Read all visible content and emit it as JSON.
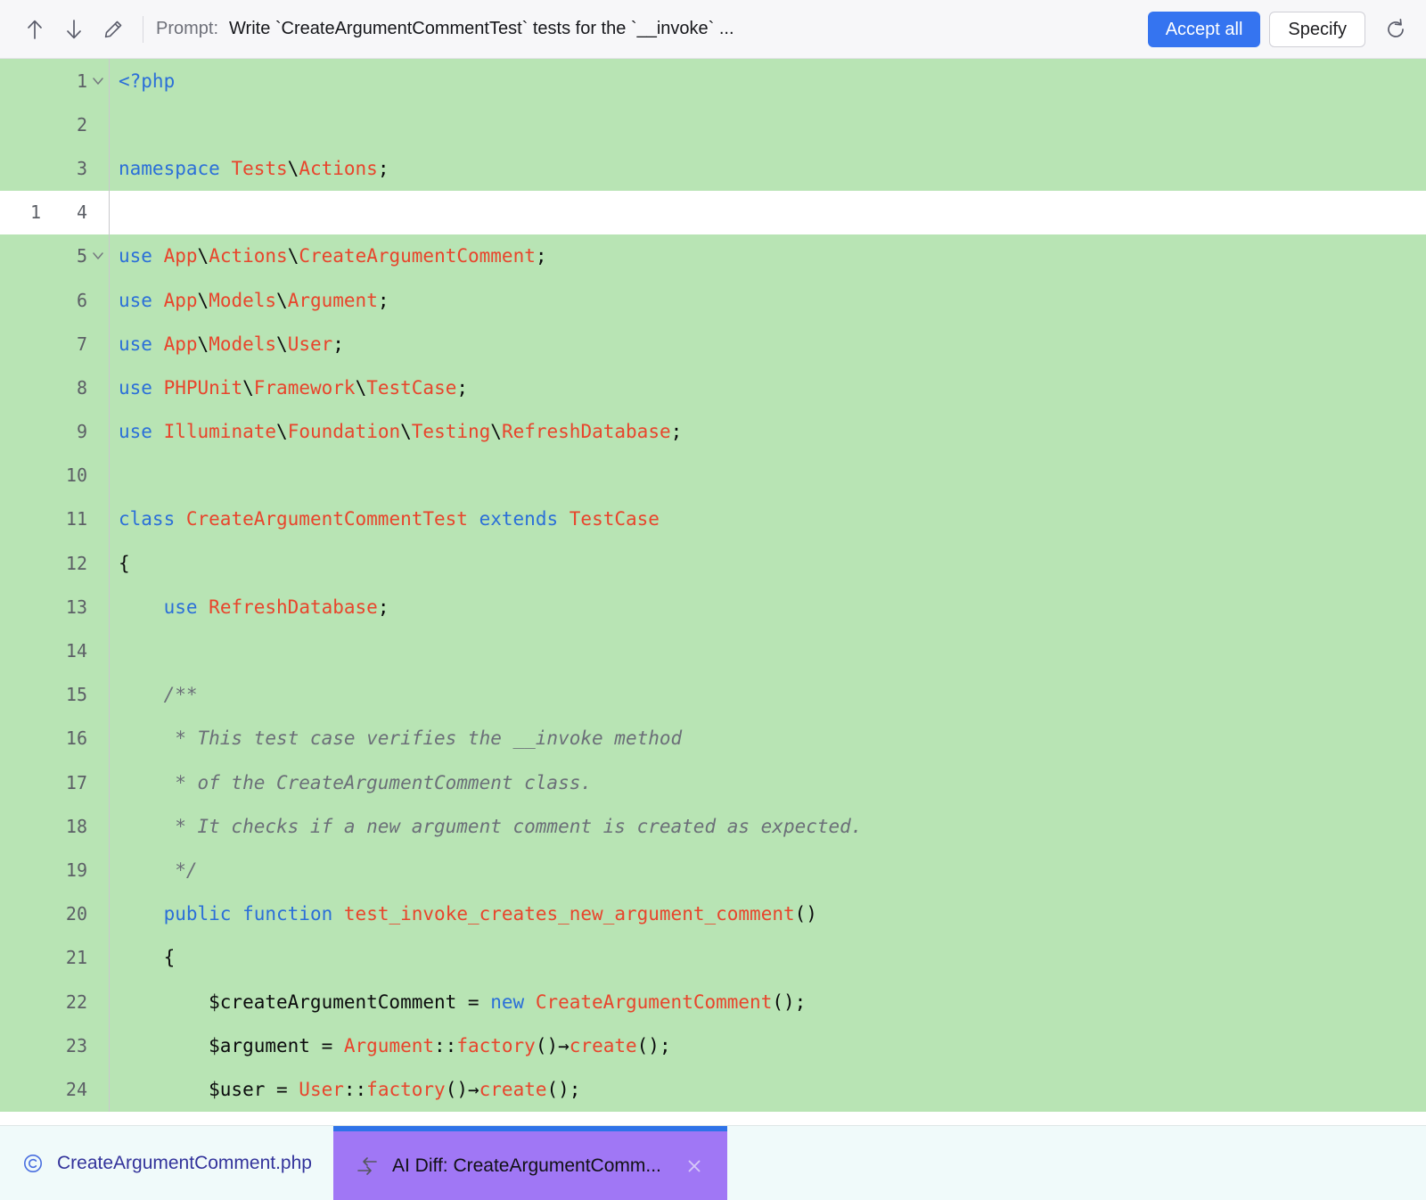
{
  "toolbar": {
    "prev_icon": "arrow-up-icon",
    "next_icon": "arrow-down-icon",
    "edit_icon": "pencil-icon",
    "prompt_label": "Prompt:",
    "prompt_text": "Write `CreateArgumentCommentTest` tests for the `__invoke` ...",
    "accept_all_label": "Accept all",
    "specify_label": "Specify",
    "refresh_icon": "refresh-icon",
    "accent_color": "#3574f0"
  },
  "editor": {
    "added_bg": "#b8e4b4",
    "context_bg": "#ffffff",
    "lines": [
      {
        "old": "",
        "new": "1",
        "fold": true,
        "type": "added",
        "tokens": [
          {
            "t": "<?php",
            "c": "tag"
          }
        ]
      },
      {
        "old": "",
        "new": "2",
        "fold": false,
        "type": "added",
        "tokens": []
      },
      {
        "old": "",
        "new": "3",
        "fold": false,
        "type": "added",
        "tokens": [
          {
            "t": "namespace",
            "c": "k"
          },
          {
            "t": " ",
            "c": "p"
          },
          {
            "t": "Tests",
            "c": "t"
          },
          {
            "t": "\\",
            "c": "p"
          },
          {
            "t": "Actions",
            "c": "t"
          },
          {
            "t": ";",
            "c": "p"
          }
        ]
      },
      {
        "old": "1",
        "new": "4",
        "fold": false,
        "type": "ctx",
        "tokens": []
      },
      {
        "old": "",
        "new": "5",
        "fold": true,
        "type": "added",
        "tokens": [
          {
            "t": "use",
            "c": "k"
          },
          {
            "t": " ",
            "c": "p"
          },
          {
            "t": "App",
            "c": "t"
          },
          {
            "t": "\\",
            "c": "p"
          },
          {
            "t": "Actions",
            "c": "t"
          },
          {
            "t": "\\",
            "c": "p"
          },
          {
            "t": "CreateArgumentComment",
            "c": "t"
          },
          {
            "t": ";",
            "c": "p"
          }
        ]
      },
      {
        "old": "",
        "new": "6",
        "fold": false,
        "type": "added",
        "tokens": [
          {
            "t": "use",
            "c": "k"
          },
          {
            "t": " ",
            "c": "p"
          },
          {
            "t": "App",
            "c": "t"
          },
          {
            "t": "\\",
            "c": "p"
          },
          {
            "t": "Models",
            "c": "t"
          },
          {
            "t": "\\",
            "c": "p"
          },
          {
            "t": "Argument",
            "c": "t"
          },
          {
            "t": ";",
            "c": "p"
          }
        ]
      },
      {
        "old": "",
        "new": "7",
        "fold": false,
        "type": "added",
        "tokens": [
          {
            "t": "use",
            "c": "k"
          },
          {
            "t": " ",
            "c": "p"
          },
          {
            "t": "App",
            "c": "t"
          },
          {
            "t": "\\",
            "c": "p"
          },
          {
            "t": "Models",
            "c": "t"
          },
          {
            "t": "\\",
            "c": "p"
          },
          {
            "t": "User",
            "c": "t"
          },
          {
            "t": ";",
            "c": "p"
          }
        ]
      },
      {
        "old": "",
        "new": "8",
        "fold": false,
        "type": "added",
        "tokens": [
          {
            "t": "use",
            "c": "k"
          },
          {
            "t": " ",
            "c": "p"
          },
          {
            "t": "PHPUnit",
            "c": "t"
          },
          {
            "t": "\\",
            "c": "p"
          },
          {
            "t": "Framework",
            "c": "t"
          },
          {
            "t": "\\",
            "c": "p"
          },
          {
            "t": "TestCase",
            "c": "t"
          },
          {
            "t": ";",
            "c": "p"
          }
        ]
      },
      {
        "old": "",
        "new": "9",
        "fold": false,
        "type": "added",
        "tokens": [
          {
            "t": "use",
            "c": "k"
          },
          {
            "t": " ",
            "c": "p"
          },
          {
            "t": "Illuminate",
            "c": "t"
          },
          {
            "t": "\\",
            "c": "p"
          },
          {
            "t": "Foundation",
            "c": "t"
          },
          {
            "t": "\\",
            "c": "p"
          },
          {
            "t": "Testing",
            "c": "t"
          },
          {
            "t": "\\",
            "c": "p"
          },
          {
            "t": "RefreshDatabase",
            "c": "t"
          },
          {
            "t": ";",
            "c": "p"
          }
        ]
      },
      {
        "old": "",
        "new": "10",
        "fold": false,
        "type": "added",
        "tokens": []
      },
      {
        "old": "",
        "new": "11",
        "fold": false,
        "type": "added",
        "tokens": [
          {
            "t": "class",
            "c": "k"
          },
          {
            "t": " ",
            "c": "p"
          },
          {
            "t": "CreateArgumentCommentTest",
            "c": "t"
          },
          {
            "t": " ",
            "c": "p"
          },
          {
            "t": "extends",
            "c": "k"
          },
          {
            "t": " ",
            "c": "p"
          },
          {
            "t": "TestCase",
            "c": "t"
          }
        ]
      },
      {
        "old": "",
        "new": "12",
        "fold": false,
        "type": "added",
        "tokens": [
          {
            "t": "{",
            "c": "p"
          }
        ]
      },
      {
        "old": "",
        "new": "13",
        "fold": false,
        "type": "added",
        "tokens": [
          {
            "t": "    ",
            "c": "p"
          },
          {
            "t": "use",
            "c": "k"
          },
          {
            "t": " ",
            "c": "p"
          },
          {
            "t": "RefreshDatabase",
            "c": "t"
          },
          {
            "t": ";",
            "c": "p"
          }
        ]
      },
      {
        "old": "",
        "new": "14",
        "fold": false,
        "type": "added",
        "tokens": []
      },
      {
        "old": "",
        "new": "15",
        "fold": false,
        "type": "added",
        "tokens": [
          {
            "t": "    /**",
            "c": "cm"
          }
        ]
      },
      {
        "old": "",
        "new": "16",
        "fold": false,
        "type": "added",
        "tokens": [
          {
            "t": "     * This test case verifies the __invoke method",
            "c": "cm"
          }
        ]
      },
      {
        "old": "",
        "new": "17",
        "fold": false,
        "type": "added",
        "tokens": [
          {
            "t": "     * of the CreateArgumentComment class.",
            "c": "cm"
          }
        ]
      },
      {
        "old": "",
        "new": "18",
        "fold": false,
        "type": "added",
        "tokens": [
          {
            "t": "     * It checks if a new argument comment is created as expected.",
            "c": "cm"
          }
        ]
      },
      {
        "old": "",
        "new": "19",
        "fold": false,
        "type": "added",
        "tokens": [
          {
            "t": "     */",
            "c": "cm"
          }
        ]
      },
      {
        "old": "",
        "new": "20",
        "fold": false,
        "type": "added",
        "tokens": [
          {
            "t": "    ",
            "c": "p"
          },
          {
            "t": "public",
            "c": "k"
          },
          {
            "t": " ",
            "c": "p"
          },
          {
            "t": "function",
            "c": "k"
          },
          {
            "t": " ",
            "c": "p"
          },
          {
            "t": "test_invoke_creates_new_argument_comment",
            "c": "fn"
          },
          {
            "t": "()",
            "c": "p"
          }
        ]
      },
      {
        "old": "",
        "new": "21",
        "fold": false,
        "type": "added",
        "tokens": [
          {
            "t": "    {",
            "c": "p"
          }
        ]
      },
      {
        "old": "",
        "new": "22",
        "fold": false,
        "type": "added",
        "tokens": [
          {
            "t": "        $createArgumentComment = ",
            "c": "p"
          },
          {
            "t": "new",
            "c": "k"
          },
          {
            "t": " ",
            "c": "p"
          },
          {
            "t": "CreateArgumentComment",
            "c": "t"
          },
          {
            "t": "();",
            "c": "p"
          }
        ]
      },
      {
        "old": "",
        "new": "23",
        "fold": false,
        "type": "added",
        "tokens": [
          {
            "t": "        $argument = ",
            "c": "p"
          },
          {
            "t": "Argument",
            "c": "t"
          },
          {
            "t": "::",
            "c": "p"
          },
          {
            "t": "factory",
            "c": "fn"
          },
          {
            "t": "()",
            "c": "p"
          },
          {
            "t": "→",
            "c": "p"
          },
          {
            "t": "create",
            "c": "fn"
          },
          {
            "t": "();",
            "c": "p"
          }
        ]
      },
      {
        "old": "",
        "new": "24",
        "fold": false,
        "type": "added",
        "tokens": [
          {
            "t": "        $user = ",
            "c": "p"
          },
          {
            "t": "User",
            "c": "t"
          },
          {
            "t": "::",
            "c": "p"
          },
          {
            "t": "factory",
            "c": "fn"
          },
          {
            "t": "()",
            "c": "p"
          },
          {
            "t": "→",
            "c": "p"
          },
          {
            "t": "create",
            "c": "fn"
          },
          {
            "t": "();",
            "c": "p"
          }
        ]
      }
    ]
  },
  "tabs": [
    {
      "label": "CreateArgumentComment.php",
      "icon": "php-class-icon",
      "active": false,
      "closable": false
    },
    {
      "label": "AI Diff: CreateArgumentComm...",
      "icon": "diff-arrows-icon",
      "active": true,
      "closable": true,
      "close_icon": "close-icon",
      "active_bg": "#a077f5",
      "active_border": "#2f73e8"
    }
  ]
}
